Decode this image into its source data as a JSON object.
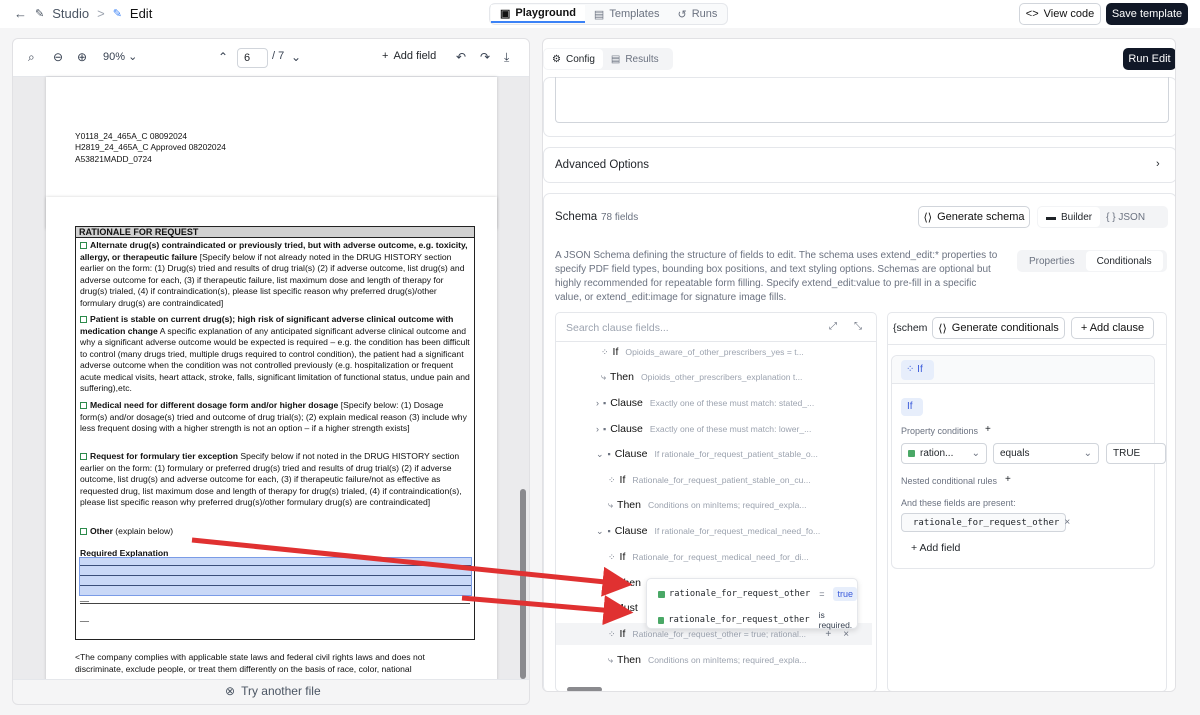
{
  "topbar": {
    "back_icon": "arrow-left-icon",
    "studio": "Studio",
    "sep": ">",
    "edit": "Edit",
    "tabs": [
      {
        "label": "Playground"
      },
      {
        "label": "Templates"
      },
      {
        "label": "Runs"
      }
    ],
    "view_code": "View code",
    "save_template": "Save template"
  },
  "pdf_toolbar": {
    "zoom": "90%",
    "page": "6",
    "page_total": "/ 7",
    "add_field": "Add field"
  },
  "page_top": {
    "lines": [
      "Y0118_24_465A_C 08092024",
      "H2819_24_465A_C Approved 08202024",
      "A53821MADD_0724"
    ]
  },
  "form": {
    "header": "RATIONALE FOR REQUEST",
    "s1_bold": "Alternate drug(s) contraindicated or previously tried, but with adverse outcome, e.g. toxicity, allergy, or therapeutic failure",
    "s1_text": " [Specify below if not already noted in the DRUG HISTORY section earlier on the form: (1) Drug(s) tried and results of drug trial(s) (2) if adverse outcome, list drug(s) and adverse outcome for each, (3) if therapeutic failure, list maximum dose and length of therapy for  drug(s) trialed, (4) if contraindication(s), please list specific reason why preferred drug(s)/other formulary drug(s) are contraindicated]",
    "s2_bold": "Patient is stable on current drug(s); high risk of significant adverse clinical outcome with medication change",
    "s2_text": " A specific explanation of any anticipated significant adverse clinical outcome and why a significant adverse outcome would be expected is required – e.g. the condition has been difficult to control (many drugs tried, multiple drugs required to control condition), the patient had a significant adverse outcome when the condition was not controlled previously (e.g. hospitalization or frequent acute medical visits, heart attack, stroke, falls, significant limitation of functional status, undue pain and suffering),etc.",
    "s3_bold": "Medical need for different dosage form and/or higher dosage",
    "s3_text": " [Specify below: (1) Dosage form(s) and/or dosage(s) tried and outcome of drug trial(s); (2) explain medical reason (3) include why less frequent dosing with a higher strength is not an option – if a higher strength exists]",
    "s4_bold": "Request for formulary tier exception",
    "s4_text": " Specify below if not noted in the DRUG HISTORY section earlier on the form: (1) formulary or preferred drug(s) tried and results of drug trial(s) (2) if adverse outcome, list drug(s) and adverse outcome for each, (3) if therapeutic failure/not as effective as requested drug, list maximum dose and length of therapy for drug(s) trialed, (4) if contraindication(s), please list specific reason why preferred drug(s)/other formulary drug(s) are contraindicated]",
    "s5_bold": "Other",
    "s5_text": " (explain below)",
    "req_expl": "Required Explanation",
    "dash1": "__",
    "dash2": "__",
    "footer1": "<The company complies with applicable state laws and federal civil rights laws and does not",
    "footer2": "discriminate, exclude people, or treat them differently on the basis of race, color, national"
  },
  "try_another": "Try another file",
  "right": {
    "config": "Config",
    "results": "Results",
    "run_edit": "Run Edit",
    "advanced": "Advanced Options",
    "schema_title": "Schema",
    "schema_count": "78 fields",
    "gen_schema": "Generate schema",
    "builder": "Builder",
    "json": "{ }  JSON",
    "desc": "A JSON Schema defining the structure of fields to edit. The schema uses extend_edit:* properties to specify PDF field types, bounding box positions, and text styling options. Schemas are optional but highly recommended for repeatable form filling. Specify extend_edit:value to pre-fill in a specific value, or extend_edit:image for signature image fills.",
    "properties": "Properties",
    "conditionals": "Conditionals",
    "search_placeholder": "Search clause fields...",
    "schem": "{schem",
    "gen_cond": "Generate conditionals",
    "add_clause": "+ Add clause",
    "tree": [
      {
        "kw": "If",
        "ds": "Opioids_aware_of_other_prescribers_yes = t..."
      },
      {
        "kw": "Then",
        "ds": "Opioids_other_prescribers_explanation t..."
      },
      {
        "kw": "Clause",
        "ds": "Exactly one of these must match: stated_..."
      },
      {
        "kw": "Clause",
        "ds": "Exactly one of these must match: lower_..."
      },
      {
        "kw": "Clause",
        "ds": "If rationale_for_request_patient_stable_o..."
      },
      {
        "kw": "If",
        "ds": "Rationale_for_request_patient_stable_on_cu..."
      },
      {
        "kw": "Then",
        "ds": "Conditions on minItems; required_expla..."
      },
      {
        "kw": "Clause",
        "ds": "If rationale_for_request_medical_need_fo..."
      },
      {
        "kw": "If",
        "ds": "Rationale_for_request_medical_need_for_di..."
      },
      {
        "kw": "Then",
        "ds": ""
      },
      {
        "kw": "Must",
        "ds": ""
      },
      {
        "kw": "If",
        "ds": "Rationale_for_request_other = true; rational..."
      },
      {
        "kw": "Then",
        "ds": "Conditions on minItems; required_expla..."
      }
    ],
    "if_header": "If",
    "if_tag": "If",
    "prop_cond": "Property conditions",
    "prop_plus": "+",
    "field_sel": "ration...",
    "op_sel": "equals",
    "value": "TRUE",
    "nested": "Nested conditional rules",
    "nested_plus": "+",
    "present": "And these fields are present:",
    "present_field": "rationale_for_request_other",
    "remove": "×",
    "add_field": "+ Add field",
    "popup": {
      "f1": "rationale_for_request_other",
      "eq": "=",
      "v1": "true",
      "f2": "rationale_for_request_other",
      "req": "is required."
    }
  },
  "colors": {
    "accent": "#3b82f6",
    "arrow": "#e03131",
    "highlight": "#c9d8f7",
    "check": "#2c8a4b"
  }
}
